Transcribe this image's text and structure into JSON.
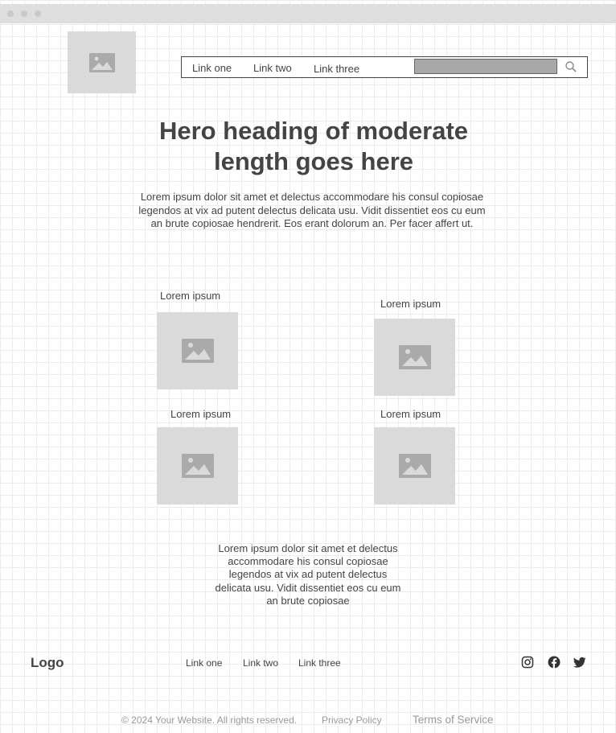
{
  "nav": {
    "links": [
      "Link one",
      "Link two",
      "Link three"
    ],
    "search_value": ""
  },
  "hero": {
    "title": "Hero heading of moderate length goes here",
    "body": "Lorem ipsum dolor sit amet et delectus accommodare his consul copiosae legendos at vix ad putent delectus delicata usu. Vidit dissentiet eos cu eum an brute copiosae hendrerit. Eos erant dolorum an. Per facer affert ut."
  },
  "cards": [
    {
      "label": "Lorem ipsum"
    },
    {
      "label": "Lorem ipsum"
    },
    {
      "label": "Lorem ipsum"
    },
    {
      "label": "Lorem ipsum"
    }
  ],
  "bottom_text": "Lorem ipsum dolor sit amet et delectus accommodare his consul copiosae legendos at vix ad putent delectus delicata usu. Vidit dissentiet eos cu eum an brute copiosae",
  "footer": {
    "logo": "Logo",
    "links": [
      "Link one",
      "Link two",
      "Link three"
    ],
    "social_icons": [
      "instagram-icon",
      "facebook-icon",
      "twitter-icon"
    ],
    "copyright": "© 2024 Your Website. All rights reserved.",
    "privacy": "Privacy Policy",
    "terms": "Terms of Service"
  },
  "colors": {
    "placeholder": "#dadada",
    "placeholder_icon": "#aaaaaa",
    "text": "#444444",
    "muted": "#9a9a9a",
    "search_fill": "#a8a8a8"
  }
}
